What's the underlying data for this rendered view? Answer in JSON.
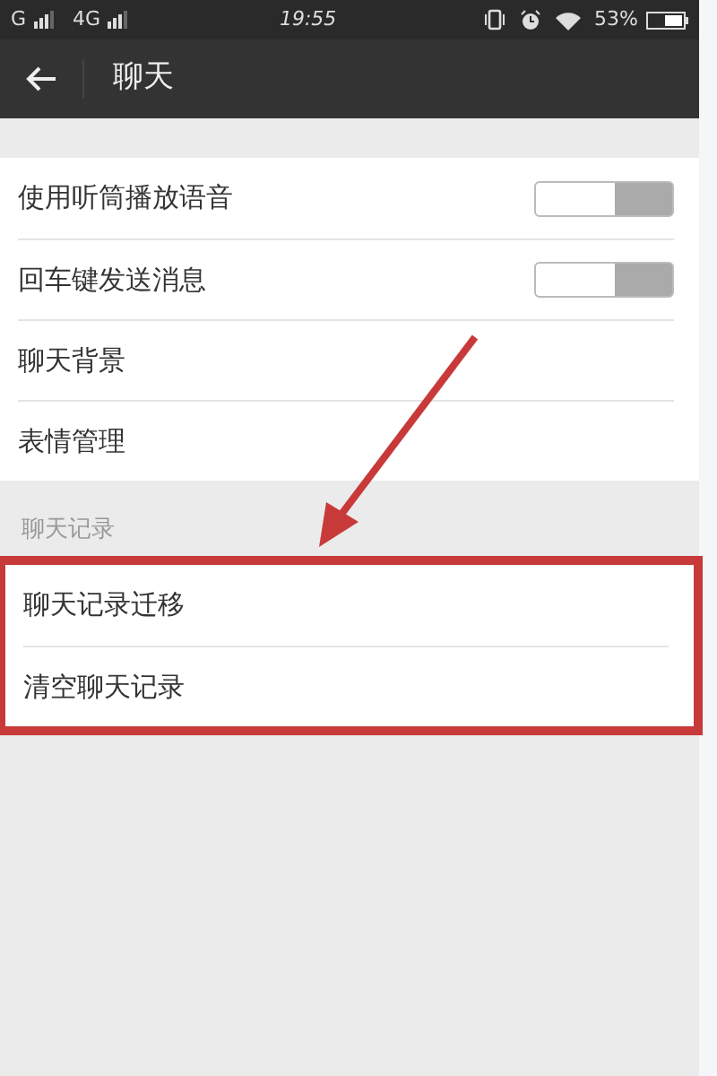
{
  "status_bar": {
    "carrier_1": "G",
    "carrier_2": "4G",
    "time": "19:55",
    "battery": "53%"
  },
  "app_bar": {
    "title": "聊天"
  },
  "sections": [
    {
      "items": [
        {
          "kind": "toggle",
          "label": "使用听筒播放语音",
          "on": false
        },
        {
          "kind": "toggle",
          "label": "回车键发送消息",
          "on": false
        },
        {
          "kind": "link",
          "label": "聊天背景"
        },
        {
          "kind": "link",
          "label": "表情管理"
        }
      ],
      "highlighted": false
    },
    {
      "header": "聊天记录",
      "items": [
        {
          "kind": "link",
          "label": "聊天记录迁移"
        },
        {
          "kind": "link",
          "label": "清空聊天记录"
        }
      ],
      "highlighted": true
    }
  ]
}
